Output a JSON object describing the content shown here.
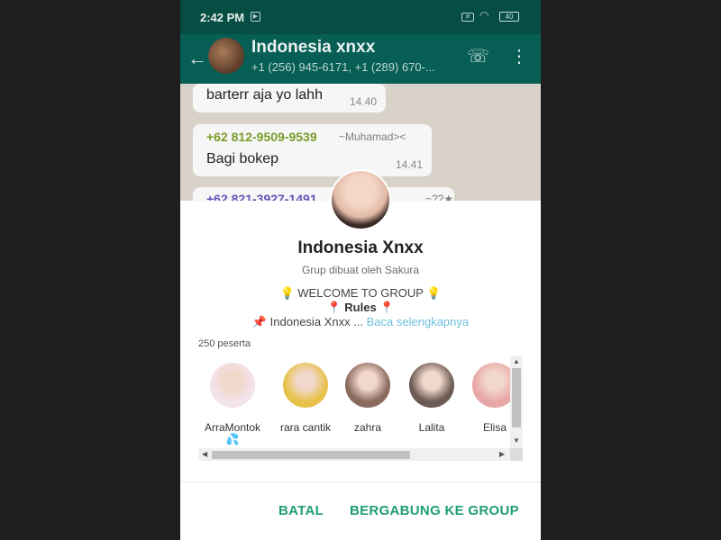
{
  "statusbar": {
    "time": "2:42 PM",
    "battery": "40"
  },
  "header": {
    "title": "Indonesia xnxx",
    "participants": "+1 (256) 945-6171, +1 (289) 670-..."
  },
  "chat": {
    "messages": [
      {
        "text": "barterr aja yo lahh",
        "time": "14.40"
      },
      {
        "phone": "+62 812-9509-9539",
        "name": "~Muhamad><",
        "text": "Bagi bokep",
        "time": "14.41"
      },
      {
        "phone": "+62 821-3927-1491",
        "name": "~??★"
      }
    ]
  },
  "group_sheet": {
    "name": "Indonesia Xnxx",
    "created_by": "Grup dibuat oleh Sakura",
    "desc_line1": "💡 WELCOME TO GROUP 💡",
    "desc_rules": "📍 Rules 📍",
    "desc_line3": "📌 Indonesia Xnxx ...",
    "read_more": "Baca selengkapnya",
    "participant_count": "250 peserta",
    "participants": [
      {
        "name": "ArraMontok 💦",
        "color": "#f3e3ea"
      },
      {
        "name": "rara cantik",
        "color": "#e6c24a"
      },
      {
        "name": "zahra",
        "color": "#8b6a5e"
      },
      {
        "name": "Lalita",
        "color": "#6b5b52"
      },
      {
        "name": "Elisa",
        "color": "#e8a7a7"
      }
    ],
    "cancel_label": "BATAL",
    "join_label": "BERGABUNG KE GROUP"
  },
  "colors": {
    "accent": "#1f9e6e",
    "header": "#075e54",
    "link": "#6fbfe0"
  }
}
